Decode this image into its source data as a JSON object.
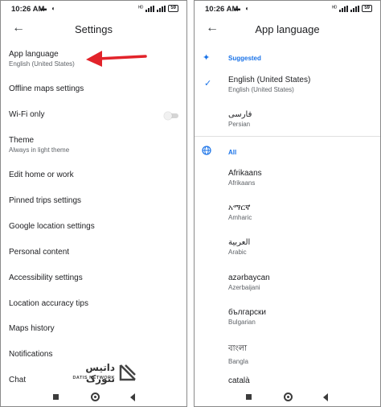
{
  "left": {
    "status": {
      "time": "10:26 AM",
      "battery": "59"
    },
    "title": "Settings",
    "items": [
      {
        "label": "App language",
        "sub": "English (United States)"
      },
      {
        "label": "Offline maps settings"
      },
      {
        "label": "Wi-Fi only"
      },
      {
        "label": "Theme",
        "sub": "Always in light theme"
      },
      {
        "label": "Edit home or work"
      },
      {
        "label": "Pinned trips settings"
      },
      {
        "label": "Google location settings"
      },
      {
        "label": "Personal content"
      },
      {
        "label": "Accessibility settings"
      },
      {
        "label": "Location accuracy tips"
      },
      {
        "label": "Maps history"
      },
      {
        "label": "Notifications"
      },
      {
        "label": "Chat"
      }
    ],
    "wifi_only_enabled": false,
    "arrow_color": "#e2232a"
  },
  "right": {
    "status": {
      "time": "10:26 AM",
      "battery": "59"
    },
    "title": "App language",
    "suggested_label": "Suggested",
    "all_label": "All",
    "suggested": [
      {
        "name": "English (United States)",
        "sub": "English (United States)",
        "selected": true
      },
      {
        "name": "فارسی",
        "sub": "Persian"
      }
    ],
    "languages": [
      {
        "name": "Afrikaans",
        "sub": "Afrikaans"
      },
      {
        "name": "አማርኛ",
        "sub": "Amharic"
      },
      {
        "name": "العربية",
        "sub": "Arabic"
      },
      {
        "name": "azərbaycan",
        "sub": "Azerbaijani"
      },
      {
        "name": "български",
        "sub": "Bulgarian"
      },
      {
        "name": "বাংলা",
        "sub": "Bangla"
      },
      {
        "name": "català",
        "sub": ""
      }
    ],
    "accent_color": "#1a73e8"
  },
  "watermark": {
    "text": "داتیس نتورک",
    "sub": "DATIS NETWORK"
  }
}
